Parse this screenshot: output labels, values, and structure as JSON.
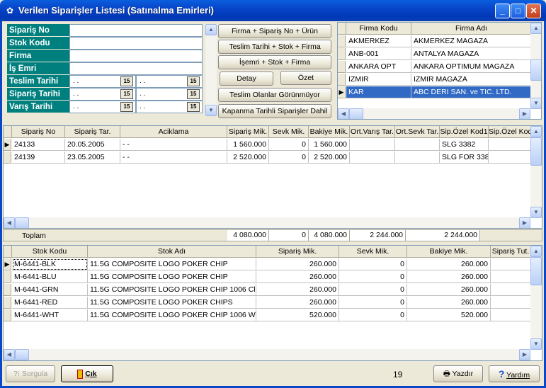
{
  "window": {
    "title": "Verilen Siparişler Listesi (Satınalma Emirleri)",
    "minimize": "_",
    "maximize": "□",
    "close": "✕"
  },
  "filters": {
    "labels": [
      "Sipariş No",
      "Stok Kodu",
      "Firma",
      "İş Emri",
      "Teslim Tarihi",
      "Sipariş Tarihi",
      "Varış Tarihi"
    ],
    "date_placeholder": ". .",
    "cal_icon": "15"
  },
  "buttons": {
    "b1": "Firma + Sipariş No + Ürün",
    "b2": "Teslim Tarihi + Stok + Firma",
    "b3": "İşemri + Stok + Firma",
    "detay": "Detay",
    "ozet": "Özet",
    "teslim_olanlar": "Teslim Olanlar Görünmüyor",
    "kapanma": "Kapanma Tarihli Siparişler Dahil"
  },
  "firm_grid": {
    "headers": [
      "Firma Kodu",
      "Firma Adı"
    ],
    "rows": [
      [
        "AKMERKEZ",
        "AKMERKEZ MAGAZA"
      ],
      [
        "ANB-001",
        "ANTALYA MAGAZA"
      ],
      [
        "ANKARA OPT",
        "ANKARA OPTIMUM MAGAZA"
      ],
      [
        "IZMIR",
        "IZMIR MAGAZA"
      ],
      [
        "KAR",
        "ABC DERI SAN. ve TIC. LTD."
      ]
    ]
  },
  "order_grid": {
    "headers": [
      "Sipariş No",
      "Sipariş Tar.",
      "Aciklama",
      "Sipariş Mik.",
      "Sevk Mik.",
      "Bakiye Mik.",
      "Ort.Varış Tar.",
      "Ort.Sevk Tar.",
      "Sip.Özel Kod1",
      "Sip.Özel Kod"
    ],
    "rows": [
      [
        "24133",
        "20.05.2005",
        "-  -",
        "1 560.000",
        "0",
        "1 560.000",
        "",
        "",
        "SLG 3382",
        ""
      ],
      [
        "24139",
        "23.05.2005",
        "-  -",
        "2 520.000",
        "0",
        "2 520.000",
        "",
        "",
        "SLG FOR 338",
        ""
      ]
    ],
    "totals_label": "Toplam",
    "totals": [
      "4 080.000",
      "0",
      "4 080.000",
      "2 244.000",
      "2 244.000"
    ]
  },
  "stock_grid": {
    "headers": [
      "Stok Kodu",
      "Stok Adı",
      "Sipariş Mik.",
      "Sevk Mik.",
      "Bakiye Mik.",
      "Sipariş Tut."
    ],
    "rows": [
      [
        "M-6441-BLK",
        "11.5G COMPOSITE LOGO POKER CHIP",
        "260.000",
        "0",
        "260.000"
      ],
      [
        "M-6441-BLU",
        "11.5G COMPOSITE LOGO POKER CHIP",
        "260.000",
        "0",
        "260.000"
      ],
      [
        "M-6441-GRN",
        "11.5G COMPOSITE LOGO POKER CHIP 1006 Cl",
        "260.000",
        "0",
        "260.000"
      ],
      [
        "M-6441-RED",
        "11.5G COMPOSITE LOGO POKER  CHIPS",
        "260.000",
        "0",
        "260.000"
      ],
      [
        "M-6441-WHT",
        "11.5G COMPOSITE LOGO POKER CHIP 1006 W",
        "520.000",
        "0",
        "520.000"
      ]
    ]
  },
  "footer": {
    "sorgula": "Sorgula",
    "cik": "Çık",
    "count": "19",
    "yazdir": "Yazdır",
    "yardim": "Yardım"
  }
}
